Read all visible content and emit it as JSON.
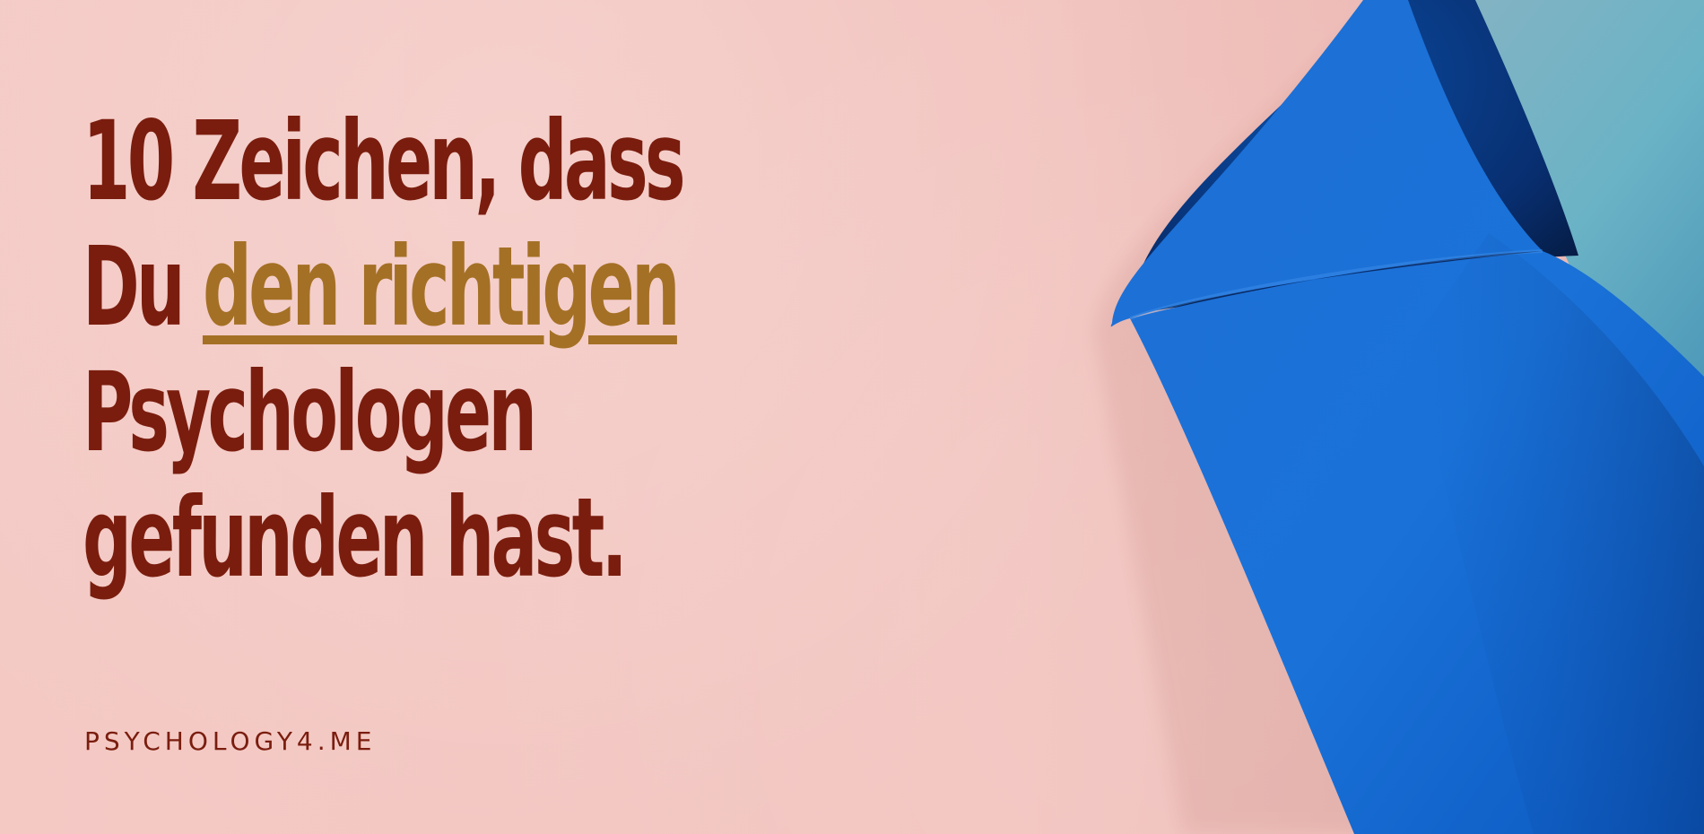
{
  "headline": {
    "line1": "10 Zeichen, dass",
    "line2_prefix": "Du",
    "line2_accent": "den richtigen",
    "line3": "Psychologen",
    "line4": "gefunden hast."
  },
  "brand": {
    "text": "PSYCHOLOGY4.ME"
  },
  "colors": {
    "background": "#f2c6c1",
    "headline": "#7a1d0e",
    "accent": "#a47025",
    "paper_blue": "#1a6fd3",
    "paper_teal": "#6fb3c4"
  }
}
